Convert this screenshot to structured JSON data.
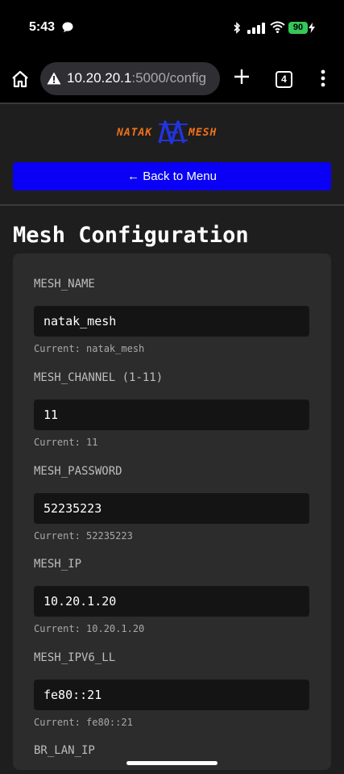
{
  "status_bar": {
    "time": "5:43",
    "battery": "90",
    "icons": [
      "message-icon",
      "bluetooth-icon",
      "signal-icon",
      "wifi-icon",
      "battery-icon",
      "charging-icon"
    ]
  },
  "browser": {
    "url_host": "10.20.20.1",
    "url_path": ":5000/config",
    "tab_count": "4",
    "icons": [
      "home-icon",
      "warning-icon",
      "plus-icon",
      "tabs-icon",
      "menu-icon"
    ]
  },
  "logo": {
    "left": "NATAK",
    "right": "MESH"
  },
  "back_button": "← Back to Menu",
  "page_title": "Mesh Configuration",
  "fields": [
    {
      "label": "MESH_NAME",
      "value": "natak_mesh",
      "current": "Current: natak_mesh"
    },
    {
      "label": "MESH_CHANNEL (1-11)",
      "value": "11",
      "current": "Current: 11"
    },
    {
      "label": "MESH_PASSWORD",
      "value": "52235223",
      "current": "Current: 52235223"
    },
    {
      "label": "MESH_IP",
      "value": "10.20.1.20",
      "current": "Current: 10.20.1.20"
    },
    {
      "label": "MESH_IPV6_LL",
      "value": "fe80::21",
      "current": "Current: fe80::21"
    },
    {
      "label": "BR_LAN_IP"
    }
  ],
  "colors": {
    "accent_button": "#0a00f5",
    "logo_orange": "#f07018",
    "logo_blue": "#2233dd",
    "battery_green": "#34c759"
  }
}
